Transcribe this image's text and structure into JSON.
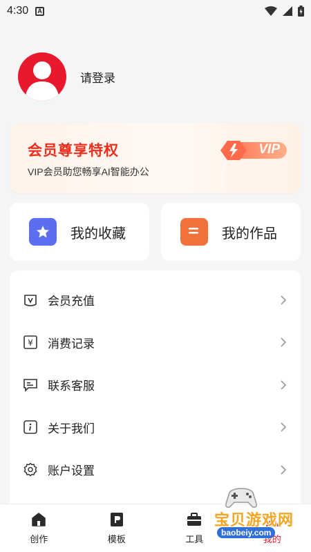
{
  "status_bar": {
    "time": "4:30",
    "notification_letter": "A"
  },
  "profile": {
    "login_text": "请登录"
  },
  "vip": {
    "title": "会员尊享特权",
    "subtitle": "VIP会员助您畅享AI智能办公",
    "badge_text": "VIP",
    "accent_color": "#ee2e1d"
  },
  "quick_actions": [
    {
      "label": "我的收藏",
      "icon": "star-icon",
      "color": "#5b6ef0"
    },
    {
      "label": "我的作品",
      "icon": "document-icon",
      "color": "#f0723a"
    }
  ],
  "menu": {
    "items": [
      {
        "label": "会员充值",
        "icon": "vip-recharge-icon"
      },
      {
        "label": "消费记录",
        "icon": "yen-receipt-icon"
      },
      {
        "label": "联系客服",
        "icon": "chat-icon"
      },
      {
        "label": "关于我们",
        "icon": "info-icon"
      },
      {
        "label": "账户设置",
        "icon": "gear-icon"
      }
    ]
  },
  "tabs": [
    {
      "label": "创作",
      "icon": "home-icon"
    },
    {
      "label": "模板",
      "icon": "template-icon"
    },
    {
      "label": "工具",
      "icon": "toolbox-icon"
    },
    {
      "label": "我的",
      "icon": "profile-icon"
    }
  ],
  "watermark": {
    "title": "宝贝游戏网",
    "url": "baobeiy.com"
  }
}
